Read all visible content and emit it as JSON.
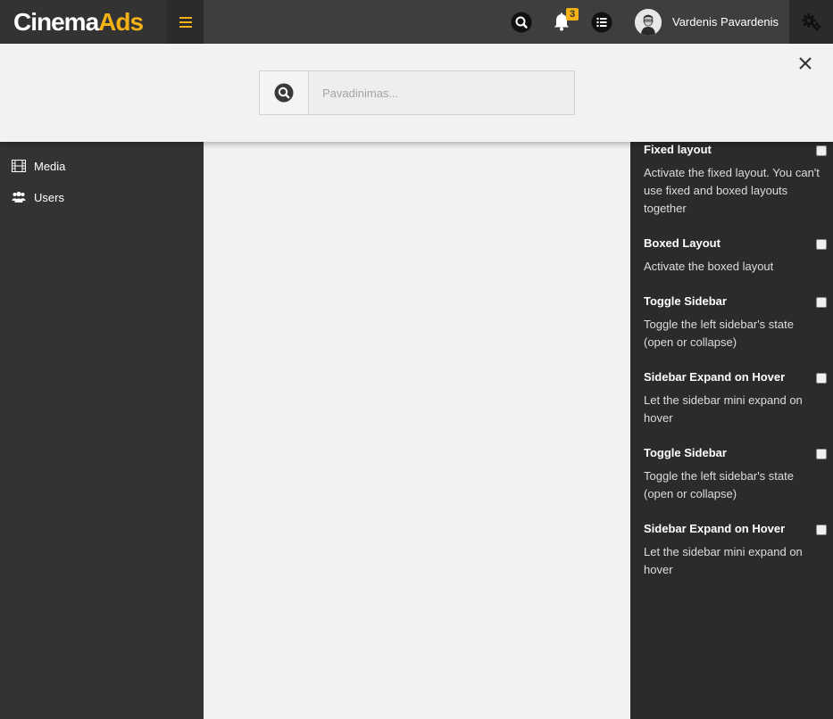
{
  "brand": {
    "name_a": "Cinema",
    "name_b": "Ads"
  },
  "header": {
    "notification_count": "3",
    "user_name": "Vardenis Pavardenis"
  },
  "sidebar": {
    "items": [
      {
        "label": "Media",
        "icon": "film-icon"
      },
      {
        "label": "Users",
        "icon": "users-icon"
      }
    ]
  },
  "search": {
    "placeholder": "Pavadinimas..."
  },
  "control_sidebar": {
    "options": [
      {
        "title": "Fixed layout",
        "desc": "Activate the fixed layout. You can't use fixed and boxed layouts together",
        "checked": false
      },
      {
        "title": "Boxed Layout",
        "desc": "Activate the boxed layout",
        "checked": false
      },
      {
        "title": "Toggle Sidebar",
        "desc": "Toggle the left sidebar's state (open or collapse)",
        "checked": false
      },
      {
        "title": "Sidebar Expand on Hover",
        "desc": "Let the sidebar mini expand on hover",
        "checked": false
      },
      {
        "title": "Toggle Sidebar",
        "desc": "Toggle the left sidebar's state (open or collapse)",
        "checked": false
      },
      {
        "title": "Sidebar Expand on Hover",
        "desc": "Let the sidebar mini expand on hover",
        "checked": false
      }
    ]
  },
  "colors": {
    "accent": "#f5b217",
    "header_bg": "#3e3e3e",
    "sidebar_bg": "#333333",
    "control_bg": "#2b2b2b",
    "content_bg": "#f2f2f2"
  }
}
